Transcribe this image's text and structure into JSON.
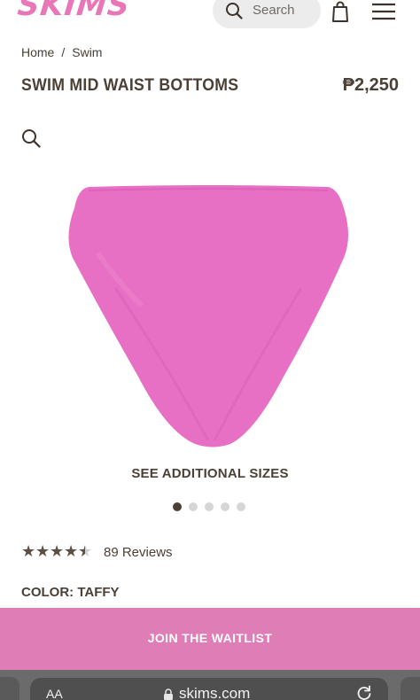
{
  "header": {
    "logo": "SKIMS",
    "search_placeholder": "Search"
  },
  "breadcrumb": {
    "items": [
      "Home",
      "Swim"
    ],
    "separator": "/"
  },
  "product": {
    "title": "SWIM MID WAIST BOTTOMS",
    "price": "₱2,250",
    "color_label": "COLOR: TAFFY",
    "image_color": "#e76fc4",
    "see_sizes": "SEE ADDITIONAL SIZES",
    "carousel": {
      "total": 5,
      "active": 1
    },
    "rating": {
      "stars": 4.5,
      "max": 5,
      "reviews_text": "89 Reviews"
    }
  },
  "cta": {
    "label": "JOIN THE WAITLIST",
    "color": "#df7db6"
  },
  "browser": {
    "aa": "AA",
    "url": "skims.com"
  },
  "colors": {
    "brand_pink": "#e977b8",
    "text": "#4b4036"
  },
  "icons": {
    "header": [
      "search-icon",
      "shopping-bag-icon",
      "hamburger-menu-icon"
    ],
    "page": [
      "zoom-icon",
      "star-icon"
    ],
    "browser": [
      "lock-icon",
      "reload-icon"
    ]
  }
}
